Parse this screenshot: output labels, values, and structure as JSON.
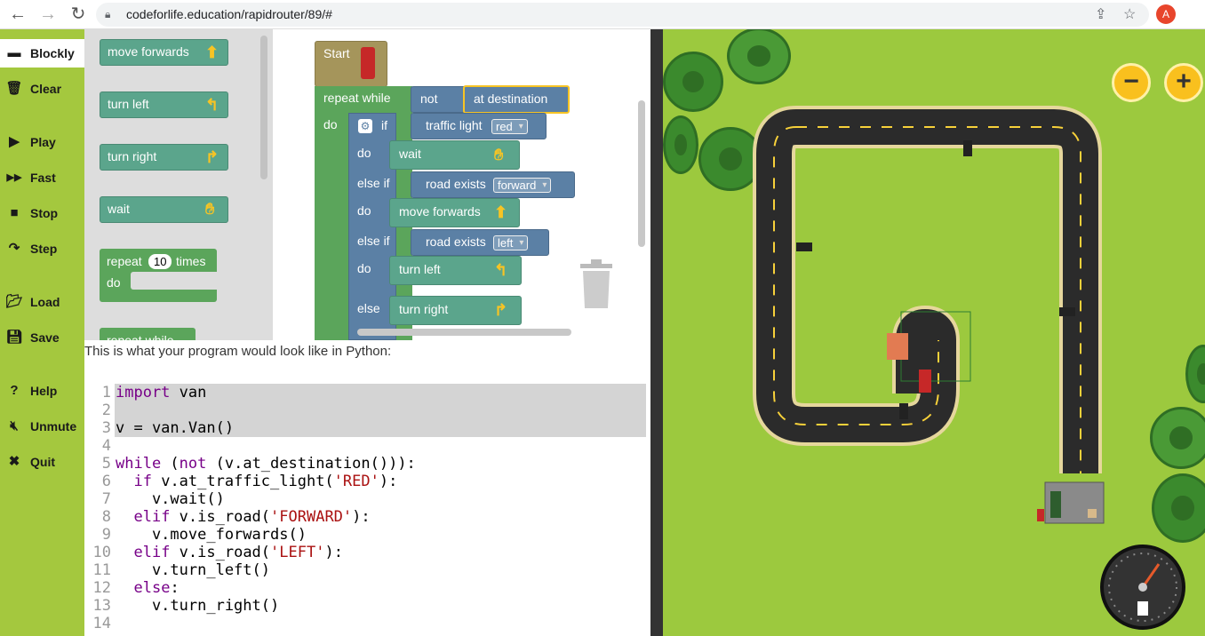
{
  "browser": {
    "url": "codeforlife.education/rapidrouter/89/#",
    "avatar_letter": "A"
  },
  "menu": {
    "items": [
      {
        "label": "Blockly",
        "icon": "blockly-icon"
      },
      {
        "label": "Clear",
        "icon": "trash-icon"
      },
      {
        "label": "Play",
        "icon": "play-icon"
      },
      {
        "label": "Fast",
        "icon": "fast-forward-icon"
      },
      {
        "label": "Stop",
        "icon": "stop-icon"
      },
      {
        "label": "Step",
        "icon": "step-icon"
      },
      {
        "label": "Load",
        "icon": "folder-icon"
      },
      {
        "label": "Save",
        "icon": "save-icon"
      },
      {
        "label": "Help",
        "icon": "help-icon"
      },
      {
        "label": "Unmute",
        "icon": "mute-icon"
      },
      {
        "label": "Quit",
        "icon": "close-icon"
      }
    ]
  },
  "toolbox": {
    "move_forwards": "move forwards",
    "turn_left": "turn left",
    "turn_right": "turn right",
    "wait": "wait",
    "repeat": "repeat",
    "repeat_count": "10",
    "times": "times",
    "do": "do",
    "repeat_while": "repeat while"
  },
  "program": {
    "start": "Start",
    "repeat_while": "repeat while",
    "not": "not",
    "at_destination": "at destination",
    "do": "do",
    "if": "if",
    "traffic_light": "traffic light",
    "red": "red",
    "wait": "wait",
    "else_if": "else if",
    "road_exists": "road exists",
    "forward": "forward",
    "move_forwards": "move forwards",
    "left": "left",
    "turn_left": "turn left",
    "else": "else",
    "turn_right": "turn right"
  },
  "python": {
    "header": "This is what your program would look like in Python:",
    "lines": [
      "import van",
      "",
      "v = van.Van()",
      "",
      "while (not (v.at_destination())):",
      "  if v.at_traffic_light('RED'):",
      "    v.wait()",
      "  elif v.is_road('FORWARD'):",
      "    v.move_forwards()",
      "  elif v.is_road('LEFT'):",
      "    v.turn_left()",
      "  else:",
      "    v.turn_right()",
      ""
    ]
  },
  "map": {
    "zoom_out": "−",
    "zoom_in": "+"
  }
}
